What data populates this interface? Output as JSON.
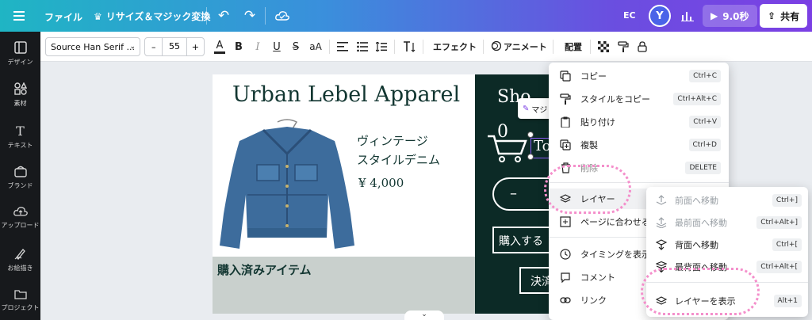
{
  "topbar": {
    "file": "ファイル",
    "resize": "リサイズ＆マジック変換",
    "initials": "EC",
    "avatar": "Y",
    "play_time": "9.0秒",
    "share": "共有"
  },
  "sidebar": {
    "items": [
      {
        "label": "デザイン",
        "icon": "design-icon"
      },
      {
        "label": "素材",
        "icon": "elements-icon"
      },
      {
        "label": "テキスト",
        "icon": "text-icon"
      },
      {
        "label": "ブランド",
        "icon": "brand-icon"
      },
      {
        "label": "アップロード",
        "icon": "upload-icon"
      },
      {
        "label": "お絵描き",
        "icon": "draw-icon"
      },
      {
        "label": "プロジェクト",
        "icon": "project-icon"
      }
    ]
  },
  "toolbar": {
    "font": "Source Han Serif ...",
    "size_minus": "–",
    "size": "55",
    "size_plus": "+",
    "color_letter": "A",
    "bold": "B",
    "italic": "I",
    "underline": "U",
    "strike": "S",
    "case": "aA",
    "effects": "エフェクト",
    "animate": "アニメート",
    "position": "配置"
  },
  "canvas": {
    "title": "Urban Lebel Apparel",
    "vintage_line1": "ヴィンテージ",
    "vintage_line2": "スタイルデニム",
    "price": "¥ 4,000",
    "purchased": "購入済みアイテム",
    "right_title": "Sho",
    "cart_count": "0",
    "cart_label": "To",
    "buy": "購入する",
    "checkout": "決済",
    "minus": "–",
    "magic_label": "マジ"
  },
  "context_menu": {
    "items": [
      {
        "label": "コピー",
        "shortcut": "Ctrl+C",
        "icon": "copy-icon"
      },
      {
        "label": "スタイルをコピー",
        "shortcut": "Ctrl+Alt+C",
        "icon": "paint-roller-icon"
      },
      {
        "label": "貼り付け",
        "shortcut": "Ctrl+V",
        "icon": "paste-icon"
      },
      {
        "label": "複製",
        "shortcut": "Ctrl+D",
        "icon": "duplicate-icon"
      },
      {
        "label": "削除",
        "shortcut": "DELETE",
        "icon": "trash-icon"
      },
      {
        "label": "レイヤー",
        "shortcut": "",
        "icon": "layers-icon"
      },
      {
        "label": "ページに合わせる",
        "shortcut": "",
        "icon": "fit-icon"
      },
      {
        "label": "タイミングを表示",
        "shortcut": "",
        "icon": "clock-icon"
      },
      {
        "label": "コメント",
        "shortcut": "",
        "icon": "comment-icon"
      },
      {
        "label": "リンク",
        "shortcut": "",
        "icon": "link-icon"
      }
    ]
  },
  "layer_submenu": {
    "items": [
      {
        "label": "前面へ移動",
        "shortcut": "Ctrl+]",
        "icon": "bring-forward-icon",
        "enabled": false
      },
      {
        "label": "最前面へ移動",
        "shortcut": "Ctrl+Alt+]",
        "icon": "bring-to-front-icon",
        "enabled": false
      },
      {
        "label": "背面へ移動",
        "shortcut": "Ctrl+[",
        "icon": "send-backward-icon",
        "enabled": true
      },
      {
        "label": "最背面へ移動",
        "shortcut": "Ctrl+Alt+[",
        "icon": "send-to-back-icon",
        "enabled": true
      },
      {
        "label": "レイヤーを表示",
        "shortcut": "Alt+1",
        "icon": "layers-icon",
        "enabled": true
      }
    ]
  },
  "colors": {
    "brand_dark": "#0c2a26",
    "title_color": "#123631",
    "highlight": "#f48fcb"
  }
}
